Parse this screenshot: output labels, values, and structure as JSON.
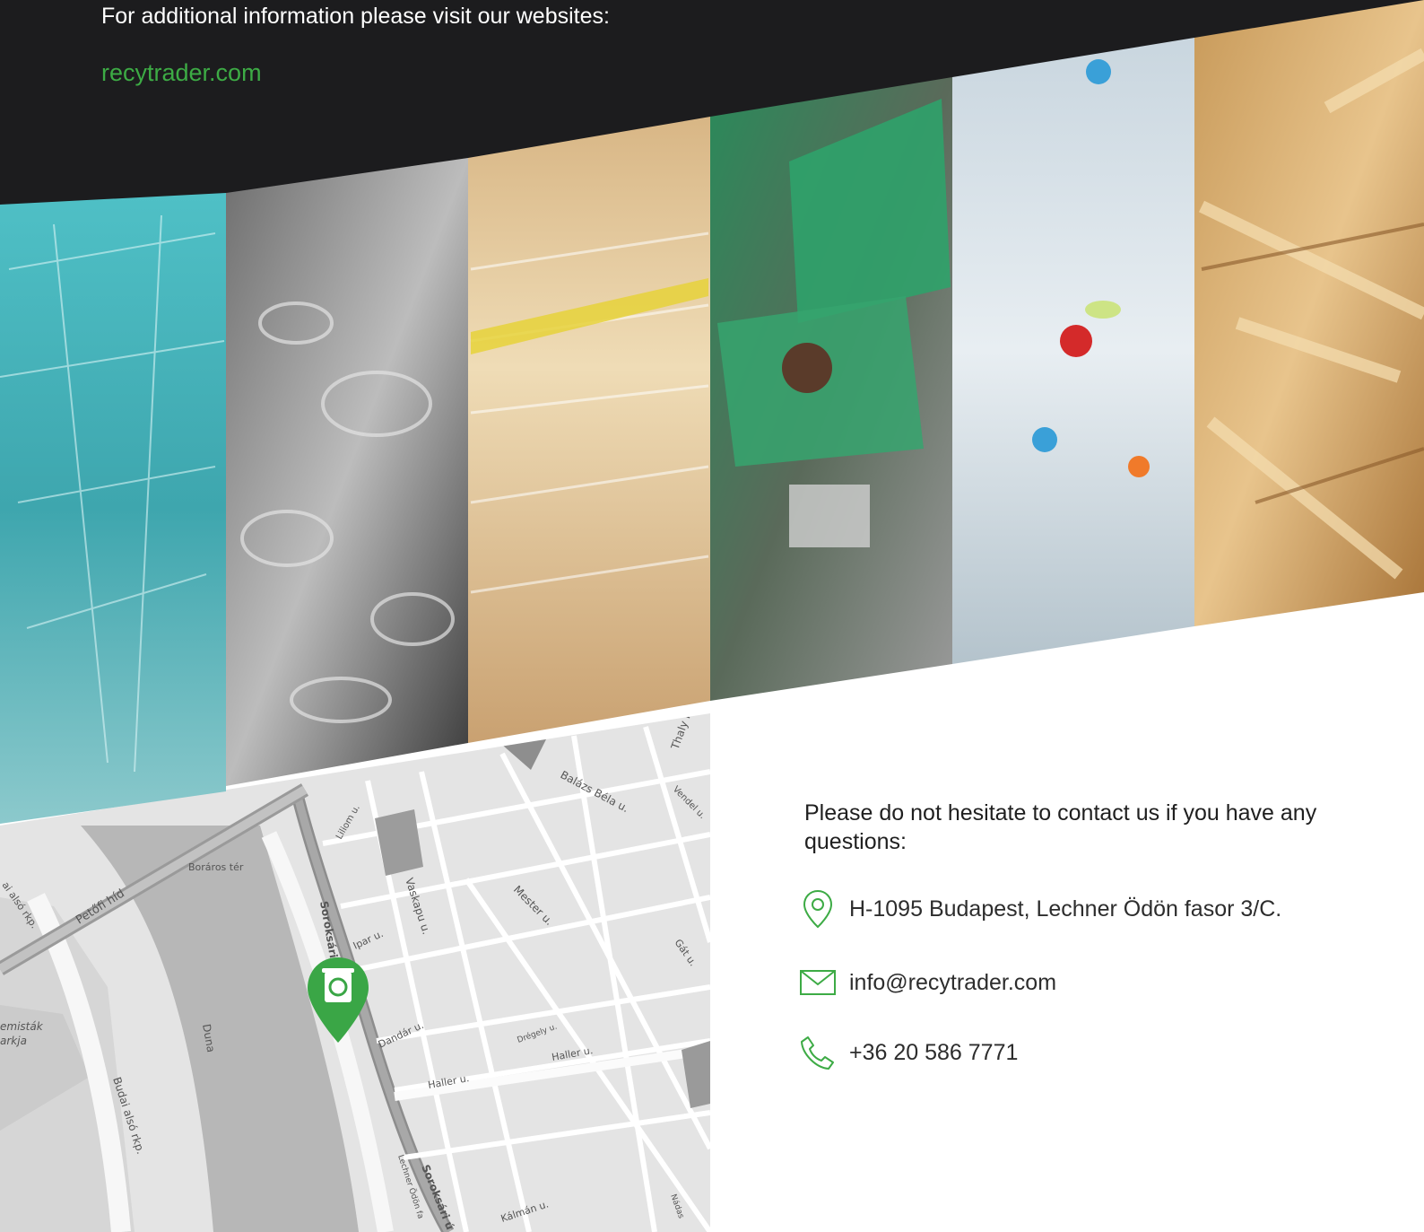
{
  "header": {
    "info_text": "For additional information please visit our websites:",
    "website": "recytrader.com"
  },
  "gallery": {
    "panels": [
      "glass-photo",
      "metal-scrap-photo",
      "paper-photo",
      "electronics-photo",
      "plastic-bottles-photo",
      "wood-photo"
    ]
  },
  "map": {
    "labels": {
      "petofi_hid": "Petőfi híd",
      "boraros_ter": "Boráros tér",
      "liliom_u": "Liliom u.",
      "vaskapu_u": "Vaskapu u.",
      "ipar_u": "Ipar u.",
      "soroksari_top": "Soroksári",
      "soroksari_bottom": "Soroksári ú",
      "mester_u": "Mester u.",
      "balazs_bela_u": "Balázs Béla u.",
      "thaly_k": "Thaly K",
      "vendel_u": "Vendel u.",
      "gat_u": "Gát u.",
      "dandar_u": "Dandár u.",
      "dregely_u": "Drégely u.",
      "haller_u_1": "Haller u.",
      "haller_u_2": "Haller u.",
      "duna": "Duna",
      "budai_also_rkp": "Budai alsó rkp.",
      "also_rkp_top": "ai alsó rkp.",
      "lechner": "Lechner Ödön fa",
      "kalman_u": "Kálmán u.",
      "nadas": "Nádas",
      "emistak": "emisták",
      "arkja": "arkja"
    },
    "pin_icon": "recycle-bin-pin-icon"
  },
  "contact": {
    "lead": "Please do not hesitate to contact us if you have any questions:",
    "address": "H-1095 Budapest, Lechner Ödön fasor 3/C.",
    "email": "info@recytrader.com",
    "phone": "+36 20 586 7771"
  },
  "colors": {
    "accent": "#3dab45",
    "dark_band": "#1c1c1e",
    "map_bg": "#e3e3e3",
    "river": "#b6b6b6"
  }
}
